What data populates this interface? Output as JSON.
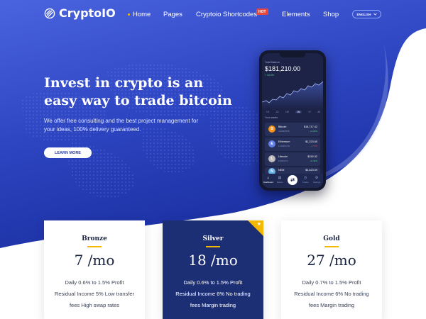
{
  "brand": {
    "name": "CryptoIO",
    "logo_icon": "crypto-logo-icon"
  },
  "nav": {
    "items": [
      {
        "label": "Home",
        "active": true
      },
      {
        "label": "Pages"
      },
      {
        "label": "Cryptoio Shortcodes",
        "badge": "HOT"
      },
      {
        "label": "Elements"
      },
      {
        "label": "Shop"
      }
    ],
    "language": "ENGLISH"
  },
  "hero": {
    "headline": "Invest in crypto is an easy way to trade bitcoin",
    "subtext": "We offer free consulting and the best project management for your ideas, 100% delivery guaranteed.",
    "cta": "LEARN MORE"
  },
  "phone": {
    "label": "Total Balance",
    "balance": "$181,210.00",
    "change": "+ 10.5%",
    "ranges": [
      "1H",
      "1D",
      "1W",
      "1M",
      "1Y",
      "All"
    ],
    "active_range": "1M",
    "section_label": "Your assets",
    "coins": [
      {
        "icon": "B",
        "name": "Bitcoin",
        "sub": "4.0000 BTC",
        "price": "$18,717.42",
        "delta": "+3.20%",
        "up": true,
        "color": "#f7931a"
      },
      {
        "icon": "E",
        "name": "Ethereum",
        "sub": "12.900 ETH",
        "price": "$1,223.65",
        "delta": "-1.71%",
        "up": false,
        "color": "#627eea"
      },
      {
        "icon": "L",
        "name": "Litecoin",
        "sub": "6.300 LTC",
        "price": "$150.32",
        "delta": "+0.42%",
        "up": true,
        "color": "#bfbbbb"
      },
      {
        "icon": "N",
        "name": "NEM",
        "sub": "100.00 XEM",
        "price": "$4,623.09",
        "delta": "+1.04%",
        "up": true,
        "color": "#67b2e8"
      }
    ],
    "tabs": [
      "Dashboard",
      "Market",
      "",
      "Trades",
      "Settings"
    ]
  },
  "pricing": [
    {
      "name": "Bronze",
      "price": "7 /mo",
      "desc": "Daily 0.6% to 1.5% Profit Residual Income 5% Low transfer fees High swap rates",
      "featured": false
    },
    {
      "name": "Silver",
      "price": "18 /mo",
      "desc": "Daily 0.6% to 1.5% Profit Residual Income 6% No trading fees Margin trading",
      "featured": true
    },
    {
      "name": "Gold",
      "price": "27 /mo",
      "desc": "Daily 0.7% to 1.5% Profit Residual Income 6% No trading fees Margin trading",
      "featured": false
    }
  ],
  "colors": {
    "hero_top": "#4b63e0",
    "hero_bottom": "#1a2fa0",
    "accent": "#f5b800",
    "hot_badge": "#e8453c",
    "featured_card": "#1d2f74"
  }
}
